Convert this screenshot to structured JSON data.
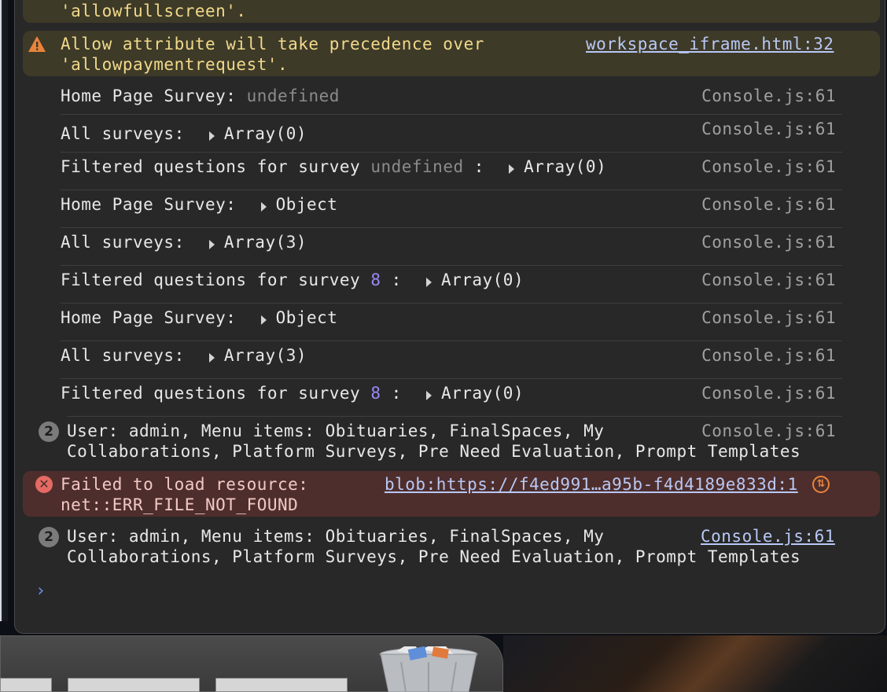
{
  "console": {
    "warning_partial": "'allowfullscreen'.",
    "warning": {
      "line1": "Allow attribute will take precedence over",
      "line2": "'allowpaymentrequest'.",
      "source": "workspace_iframe.html:32"
    },
    "logs": [
      {
        "label": "Home Page Survey:",
        "muted_value": "undefined",
        "source": "Console.js:61"
      },
      {
        "label": "All surveys:",
        "value": "Array(0)",
        "source": "Console.js:61"
      },
      {
        "label": "Filtered questions for survey",
        "muted_value": "undefined",
        "suffix": ":",
        "value": "Array(0)",
        "source": "Console.js:61"
      },
      {
        "label": "Home Page Survey:",
        "value": "Object",
        "source": "Console.js:61"
      },
      {
        "label": "All surveys:",
        "value": "Array(3)",
        "source": "Console.js:61"
      },
      {
        "label": "Filtered questions for survey",
        "num_value": "8",
        "suffix": ":",
        "value": "Array(0)",
        "source": "Console.js:61"
      },
      {
        "label": "Home Page Survey:",
        "value": "Object",
        "source": "Console.js:61"
      },
      {
        "label": "All surveys:",
        "value": "Array(3)",
        "source": "Console.js:61"
      },
      {
        "label": "Filtered questions for survey",
        "num_value": "8",
        "suffix": ":",
        "value": "Array(0)",
        "source": "Console.js:61"
      }
    ],
    "grouped1": {
      "count": "2",
      "line1": "User: admin, Menu items: Obituaries, FinalSpaces, My",
      "line2": "Collaborations, Platform Surveys, Pre Need Evaluation, Prompt Templates",
      "source": "Console.js:61"
    },
    "error": {
      "line1": "Failed to load resource:",
      "line2": "net::ERR_FILE_NOT_FOUND",
      "source": "blob:https://f4ed991…a95b-f4d4189e833d:1"
    },
    "grouped2": {
      "count": "2",
      "line1": "User: admin, Menu items: Obituaries, FinalSpaces, My",
      "line2": "Collaborations, Platform Surveys, Pre Need Evaluation, Prompt Templates",
      "source": "Console.js:61"
    },
    "prompt_symbol": "›"
  },
  "colors": {
    "panel_bg": "#282828",
    "warning_bg": "#3e3a28",
    "error_bg": "#4e2e2c",
    "number_accent": "#9b87f5",
    "link": "#b9c8f5"
  },
  "icons": [
    "warning-icon",
    "error-icon",
    "expand-triangle-icon",
    "upload-icon",
    "trash-icon",
    "prompt-chevron-icon"
  ]
}
